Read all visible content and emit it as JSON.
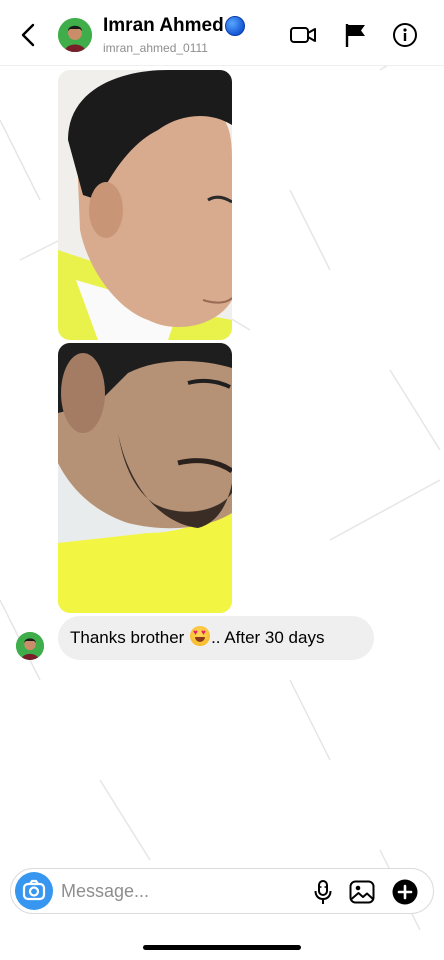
{
  "header": {
    "name": "Imran Ahmed",
    "username": "imran_ahmed_0111"
  },
  "icons": {
    "back": "chevron-left-icon",
    "video": "video-camera-icon",
    "flag": "flag-icon",
    "info": "info-icon",
    "verified": "blue-circle-icon",
    "camera": "camera-icon",
    "mic": "microphone-icon",
    "gallery": "image-icon",
    "add": "plus-circle-icon"
  },
  "colors": {
    "accent": "#3797f0",
    "bubble": "#efefef",
    "avatar_bg": "#3fae4a",
    "shirt": "#f0f542"
  },
  "messages": [
    {
      "type": "image",
      "description": "side profile photo 1"
    },
    {
      "type": "image",
      "description": "side profile photo 2"
    },
    {
      "type": "text",
      "text_before": "Thanks brother ",
      "emoji": "heart-eyes",
      "text_after": ".. After 30 days"
    }
  ],
  "composer": {
    "placeholder": "Message..."
  }
}
